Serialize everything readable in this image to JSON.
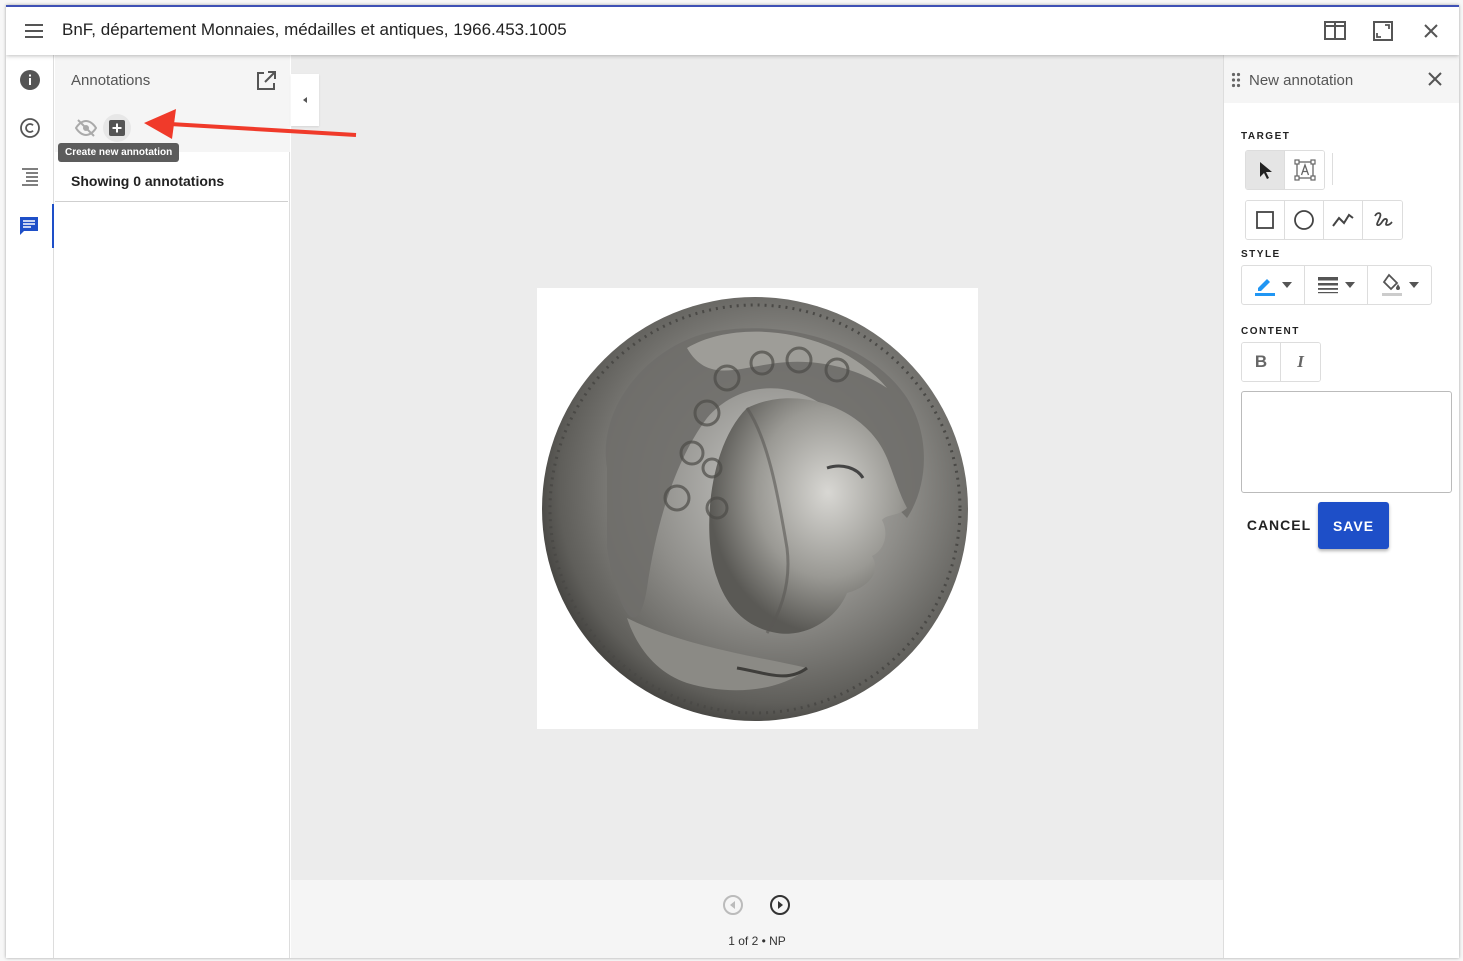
{
  "window": {
    "title": "BnF, département Monnaies, médailles et antiques, 1966.453.1005"
  },
  "annotations_panel": {
    "title": "Annotations",
    "tooltip": "Create new annotation",
    "count_text": "Showing 0 annotations"
  },
  "navigation": {
    "page_indicator": "1 of 2 • NP"
  },
  "companion": {
    "title": "New annotation",
    "target_label": "TARGET",
    "style_label": "STYLE",
    "content_label": "CONTENT",
    "bold_label": "B",
    "italic_label": "I",
    "cancel_label": "CANCEL",
    "save_label": "SAVE",
    "editor_value": ""
  },
  "colors": {
    "accent": "#1e4fc8",
    "stroke_color": "#2196f3",
    "arrow": "#f03a2a"
  },
  "icons": {
    "left_rail": [
      "info-icon",
      "copyright-icon",
      "table-of-contents-icon",
      "annotations-icon"
    ],
    "target_tools": [
      "cursor-icon",
      "image-select-icon"
    ],
    "shape_tools": [
      "rectangle-icon",
      "ellipse-icon",
      "polyline-icon",
      "freehand-icon"
    ],
    "style_tools": [
      "stroke-color-icon",
      "line-weight-icon",
      "fill-color-icon"
    ]
  }
}
